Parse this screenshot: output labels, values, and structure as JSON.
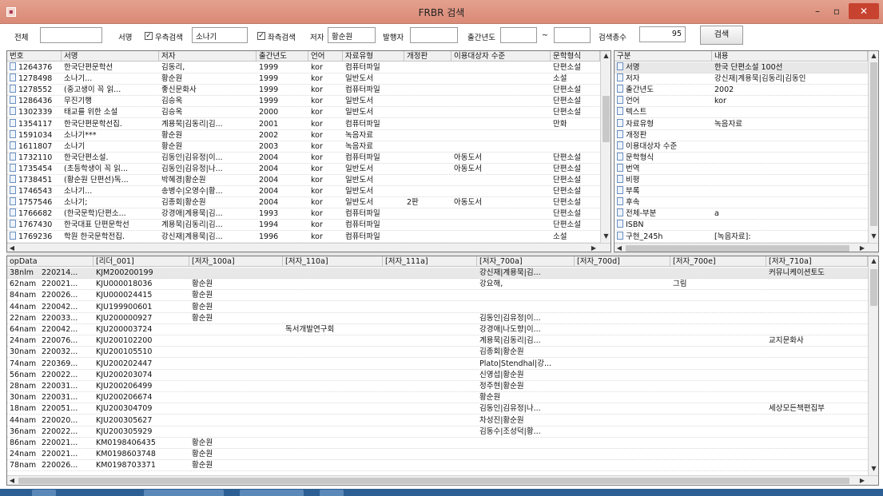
{
  "window": {
    "title": "FRBR 검색",
    "min": "–",
    "max": "▫",
    "close": "✕"
  },
  "toolbar": {
    "all_label": "전체",
    "all_value": "",
    "title_label": "서명",
    "right_truncation_label": "우측검색",
    "right_truncation_checked": true,
    "title_value": "소나기",
    "left_truncation_label": "좌측검색",
    "left_truncation_checked": true,
    "author_label": "저자",
    "author_value": "황순원",
    "publisher_label": "발행자",
    "publisher_value": "",
    "pub_year_label": "출간년도",
    "pub_year_from": "",
    "range_sep": "~",
    "pub_year_to": "",
    "total_label": "검색총수",
    "total_value": "95",
    "search_button": "검색"
  },
  "results": {
    "columns": [
      "번호",
      "서명",
      "저자",
      "출간년도",
      "언어",
      "자료유형",
      "개정판",
      "이용대상자 수준",
      "문학형식"
    ],
    "rows": [
      [
        "1264376",
        "한국단편문학선",
        "김동리,",
        "1999",
        "kor",
        "컴퓨터파일",
        "",
        "",
        "단편소설"
      ],
      [
        "1278498",
        "소나기...",
        "황순원",
        "1999",
        "kor",
        "일반도서",
        "",
        "",
        "소설"
      ],
      [
        "1278552",
        "(중고생이 꼭 읽...",
        "좋신문화사",
        "1999",
        "kor",
        "컴퓨터파일",
        "",
        "",
        "단편소설"
      ],
      [
        "1286436",
        "무진기행",
        "김승옥",
        "1999",
        "kor",
        "일반도서",
        "",
        "",
        "단편소설"
      ],
      [
        "1302339",
        "태교를 위한 소설",
        "김승옥",
        "2000",
        "kor",
        "일반도서",
        "",
        "",
        "단편소설"
      ],
      [
        "1354117",
        "한국단편문학선집.",
        "계용묵|김동리|김...",
        "2001",
        "kor",
        "컴퓨터파일",
        "",
        "",
        "만화"
      ],
      [
        "1591034",
        "소나기***",
        "황순원",
        "2002",
        "kor",
        "녹음자료",
        "",
        "",
        ""
      ],
      [
        "1611807",
        "소나기",
        "황순원",
        "2003",
        "kor",
        "녹음자료",
        "",
        "",
        ""
      ],
      [
        "1732110",
        "한국단편소설.",
        "김동인|김유정|이...",
        "2004",
        "kor",
        "컴퓨터파일",
        "",
        "아동도서",
        "단편소설"
      ],
      [
        "1735454",
        "(초등학생이 꼭 읽...",
        "김동인|김유정|나...",
        "2004",
        "kor",
        "일반도서",
        "",
        "아동도서",
        "단편소설"
      ],
      [
        "1738451",
        "(황순원 단편선)독...",
        "박혜경|황순원",
        "2004",
        "kor",
        "일반도서",
        "",
        "",
        "단편소설"
      ],
      [
        "1746543",
        "소나기...",
        "송병수|오영수|황...",
        "2004",
        "kor",
        "일반도서",
        "",
        "",
        "단편소설"
      ],
      [
        "1757546",
        "소나기;",
        "김종회|황순원",
        "2004",
        "kor",
        "일반도서",
        "2판",
        "아동도서",
        "단편소설"
      ],
      [
        "1766682",
        "(한국문학)단편소...",
        "강경애|계용묵|김...",
        "1993",
        "kor",
        "컴퓨터파일",
        "",
        "",
        "단편소설"
      ],
      [
        "1767430",
        "한국대표 단편문학선",
        "계용묵|김동리|김...",
        "1994",
        "kor",
        "컴퓨터파일",
        "",
        "",
        "단편소설"
      ],
      [
        "1769236",
        "학원 한국문학전집.",
        "강신재|계용묵|김...",
        "1996",
        "kor",
        "컴퓨터파일",
        "",
        "",
        "소설"
      ]
    ]
  },
  "detail": {
    "columns": [
      "구분",
      "내용"
    ],
    "rows": [
      [
        "서명",
        "한국 단편소설 100선"
      ],
      [
        "저자",
        "강신재|계용묵|김동리|김동인"
      ],
      [
        "출간년도",
        "2002"
      ],
      [
        "언어",
        "kor"
      ],
      [
        "텍스트",
        ""
      ],
      [
        "자료유형",
        "녹음자료"
      ],
      [
        "개정판",
        ""
      ],
      [
        "이용대상자 수준",
        ""
      ],
      [
        "문학형식",
        ""
      ],
      [
        "번역",
        ""
      ],
      [
        "비평",
        ""
      ],
      [
        "부록",
        ""
      ],
      [
        "후속",
        ""
      ],
      [
        "전체-부분",
        "a"
      ],
      [
        "ISBN",
        ""
      ],
      [
        "구현_245h",
        "[녹음자료]:"
      ]
    ]
  },
  "marc": {
    "columns": [
      "opData",
      "[리더_001]",
      "[저자_100a]",
      "[저자_110a]",
      "[저자_111a]",
      "[저자_700a]",
      "[저자_700d]",
      "[저자_700e]",
      "[저자_710a]"
    ],
    "rows": [
      [
        "38nlm",
        "220214...",
        "KJM200200199",
        "",
        "",
        "",
        "강신재|계용묵|김...",
        "",
        "",
        "커뮤니케이션토도"
      ],
      [
        "62nam",
        "220021...",
        "KJU000018036",
        "황순원",
        "",
        "",
        "강요해,",
        "",
        "그림",
        ""
      ],
      [
        "84nam",
        "220026...",
        "KJU000024415",
        "황순원",
        "",
        "",
        "",
        "",
        "",
        ""
      ],
      [
        "44nam",
        "220042...",
        "KJU199900601",
        "황순원",
        "",
        "",
        "",
        "",
        "",
        ""
      ],
      [
        "22nam",
        "220033...",
        "KJU200000927",
        "황순원",
        "",
        "",
        "김동인|김유정|이...",
        "",
        "",
        ""
      ],
      [
        "64nam",
        "220042...",
        "KJU200003724",
        "",
        "독서개발연구회",
        "",
        "강경애|나도향|이...",
        "",
        "",
        ""
      ],
      [
        "24nam",
        "220076...",
        "KJU200102200",
        "",
        "",
        "",
        "계용묵|김동리|김...",
        "",
        "",
        "교지문화사"
      ],
      [
        "30nam",
        "220032...",
        "KJU200105510",
        "",
        "",
        "",
        "김종회|황순원",
        "",
        "",
        ""
      ],
      [
        "74nam",
        "220369...",
        "KJU200202447",
        "",
        "",
        "",
        "Plato|Stendhal|강...",
        "",
        "",
        ""
      ],
      [
        "56nam",
        "220022...",
        "KJU200203074",
        "",
        "",
        "",
        "신영섭|황순원",
        "",
        "",
        ""
      ],
      [
        "28nam",
        "220031...",
        "KJU200206499",
        "",
        "",
        "",
        "정주현|황순원",
        "",
        "",
        ""
      ],
      [
        "30nam",
        "220031...",
        "KJU200206674",
        "",
        "",
        "",
        "황순원",
        "",
        "",
        ""
      ],
      [
        "18nam",
        "220051...",
        "KJU200304709",
        "",
        "",
        "",
        "김동인|김유정|나...",
        "",
        "",
        "세상모든책편집부"
      ],
      [
        "44nam",
        "220020...",
        "KJU200305627",
        "",
        "",
        "",
        "차성진|황순원",
        "",
        "",
        ""
      ],
      [
        "36nam",
        "220022...",
        "KJU200305929",
        "",
        "",
        "",
        "김동수|조성덕|황...",
        "",
        "",
        ""
      ],
      [
        "86nam",
        "220021...",
        "KM0198406435",
        "황순원",
        "",
        "",
        "",
        "",
        "",
        ""
      ],
      [
        "24nam",
        "220021...",
        "KM0198603748",
        "황순원",
        "",
        "",
        "",
        "",
        "",
        ""
      ],
      [
        "78nam",
        "220026...",
        "KM0198703371",
        "황순원",
        "",
        "",
        "",
        "",
        "",
        ""
      ]
    ]
  },
  "scroll": {
    "up": "▲",
    "down": "▼",
    "left": "◀",
    "right": "▶"
  }
}
